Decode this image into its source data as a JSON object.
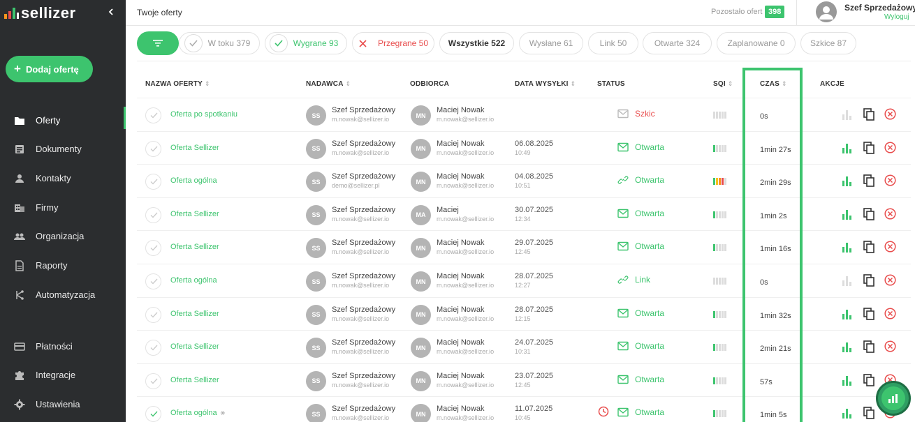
{
  "brand": {
    "name": "sellizer",
    "accent": "#3dc46e",
    "danger": "#e84c4c"
  },
  "sidebar": {
    "collapse_icon": "chevron-left-icon",
    "add_button": "Dodaj ofertę",
    "items": [
      {
        "label": "Oferty",
        "icon": "folder-icon",
        "active": true
      },
      {
        "label": "Dokumenty",
        "icon": "document-icon"
      },
      {
        "label": "Kontakty",
        "icon": "person-icon"
      },
      {
        "label": "Firmy",
        "icon": "building-icon"
      },
      {
        "label": "Organizacja",
        "icon": "people-icon"
      },
      {
        "label": "Raporty",
        "icon": "report-icon"
      },
      {
        "label": "Automatyzacja",
        "icon": "automation-icon"
      },
      {
        "label": "Płatności",
        "icon": "card-icon"
      },
      {
        "label": "Integracje",
        "icon": "puzzle-icon"
      },
      {
        "label": "Ustawienia",
        "icon": "gear-icon"
      }
    ]
  },
  "topbar": {
    "title": "Twoje oferty",
    "remaining_label": "Pozostało ofert",
    "remaining_count": "398",
    "user_name": "Szef Sprzedażowy",
    "logout": "Wyloguj"
  },
  "filters": [
    {
      "label": "W toku 379",
      "type": "check"
    },
    {
      "label": "Wygrane 93",
      "type": "won"
    },
    {
      "label": "Przegrane 50",
      "type": "lost"
    },
    {
      "label": "Wszystkie 522",
      "type": "all"
    },
    {
      "label": "Wysłane 61"
    },
    {
      "label": "Link 50"
    },
    {
      "label": "Otwarte 324"
    },
    {
      "label": "Zaplanowane 0"
    },
    {
      "label": "Szkice 87"
    }
  ],
  "table": {
    "headers": {
      "name": "NAZWA OFERTY",
      "sender": "NADAWCA",
      "recipient": "ODBIORCA",
      "date": "DATA WYSYŁKI",
      "status": "STATUS",
      "sqi": "SQI",
      "czas": "CZAS",
      "actions": "AKCJE"
    },
    "rows": [
      {
        "name": "Oferta po spotkaniu",
        "sender": "Szef Sprzedażowy",
        "sender_initials": "SS",
        "sender_email": "m.nowak@sellizer.io",
        "recipient": "Maciej Nowak",
        "recipient_initials": "MN",
        "recipient_email": "m.nowak@sellizer.io",
        "date": "",
        "time": "",
        "status": "Szkic",
        "status_icon": "mail-icon",
        "sqi": 0,
        "czas": "0s",
        "stats_active": false
      },
      {
        "name": "Oferta Sellizer",
        "sender": "Szef Sprzedażowy",
        "sender_initials": "SS",
        "sender_email": "m.nowak@sellizer.io",
        "recipient": "Maciej Nowak",
        "recipient_initials": "MN",
        "recipient_email": "m.nowak@sellizer.io",
        "date": "06.08.2025",
        "time": "10:49",
        "status": "Otwarta",
        "status_icon": "mail-icon",
        "sqi": 1,
        "czas": "1min 27s",
        "stats_active": true
      },
      {
        "name": "Oferta ogólna",
        "sender": "Szef Sprzedażowy",
        "sender_initials": "SS",
        "sender_email": "demo@sellizer.pl",
        "recipient": "Maciej Nowak",
        "recipient_initials": "MN",
        "recipient_email": "m.nowak@sellizer.io",
        "date": "04.08.2025",
        "time": "10:51",
        "status": "Otwarta",
        "status_icon": "link-icon",
        "sqi": 4,
        "czas": "2min 29s",
        "stats_active": true
      },
      {
        "name": "Oferta Sellizer",
        "sender": "Szef Sprzedażowy",
        "sender_initials": "SS",
        "sender_email": "m.nowak@sellizer.io",
        "recipient": "Maciej",
        "recipient_initials": "MA",
        "recipient_email": "m.nowak@sellizer.io",
        "date": "30.07.2025",
        "time": "12:34",
        "status": "Otwarta",
        "status_icon": "mail-icon",
        "sqi": 1,
        "czas": "1min 2s",
        "stats_active": true
      },
      {
        "name": "Oferta Sellizer",
        "sender": "Szef Sprzedażowy",
        "sender_initials": "SS",
        "sender_email": "m.nowak@sellizer.io",
        "recipient": "Maciej Nowak",
        "recipient_initials": "MN",
        "recipient_email": "m.nowak@sellizer.io",
        "date": "29.07.2025",
        "time": "12:45",
        "status": "Otwarta",
        "status_icon": "mail-icon",
        "sqi": 1,
        "czas": "1min 16s",
        "stats_active": true
      },
      {
        "name": "Oferta ogólna",
        "sender": "Szef Sprzedażowy",
        "sender_initials": "SS",
        "sender_email": "m.nowak@sellizer.io",
        "recipient": "Maciej Nowak",
        "recipient_initials": "MN",
        "recipient_email": "m.nowak@sellizer.io",
        "date": "28.07.2025",
        "time": "12:27",
        "status": "Link",
        "status_icon": "link-icon",
        "sqi": 0,
        "czas": "0s",
        "stats_active": false
      },
      {
        "name": "Oferta Sellizer",
        "sender": "Szef Sprzedażowy",
        "sender_initials": "SS",
        "sender_email": "m.nowak@sellizer.io",
        "recipient": "Maciej Nowak",
        "recipient_initials": "MN",
        "recipient_email": "m.nowak@sellizer.io",
        "date": "28.07.2025",
        "time": "12:15",
        "status": "Otwarta",
        "status_icon": "mail-icon",
        "sqi": 1,
        "czas": "1min 32s",
        "stats_active": true
      },
      {
        "name": "Oferta Sellizer",
        "sender": "Szef Sprzedażowy",
        "sender_initials": "SS",
        "sender_email": "m.nowak@sellizer.io",
        "recipient": "Maciej Nowak",
        "recipient_initials": "MN",
        "recipient_email": "m.nowak@sellizer.io",
        "date": "24.07.2025",
        "time": "10:31",
        "status": "Otwarta",
        "status_icon": "mail-icon",
        "sqi": 1,
        "czas": "2min 21s",
        "stats_active": true
      },
      {
        "name": "Oferta Sellizer",
        "sender": "Szef Sprzedażowy",
        "sender_initials": "SS",
        "sender_email": "m.nowak@sellizer.io",
        "recipient": "Maciej Nowak",
        "recipient_initials": "MN",
        "recipient_email": "m.nowak@sellizer.io",
        "date": "23.07.2025",
        "time": "12:45",
        "status": "Otwarta",
        "status_icon": "mail-icon",
        "sqi": 1,
        "czas": "57s",
        "stats_active": true
      },
      {
        "name": "Oferta ogólna",
        "sender": "Szef Sprzedażowy",
        "sender_initials": "SS",
        "sender_email": "m.nowak@sellizer.io",
        "recipient": "Maciej Nowak",
        "recipient_initials": "MN",
        "recipient_email": "m.nowak@sellizer.io",
        "date": "11.07.2025",
        "time": "10:45",
        "status": "Otwarta",
        "status_icon": "mail-icon",
        "sqi": 1,
        "czas": "1min 5s",
        "stats_active": true,
        "checked": true,
        "automation": true,
        "scheduled": true
      }
    ]
  },
  "fab_icon": "chart-search-icon"
}
